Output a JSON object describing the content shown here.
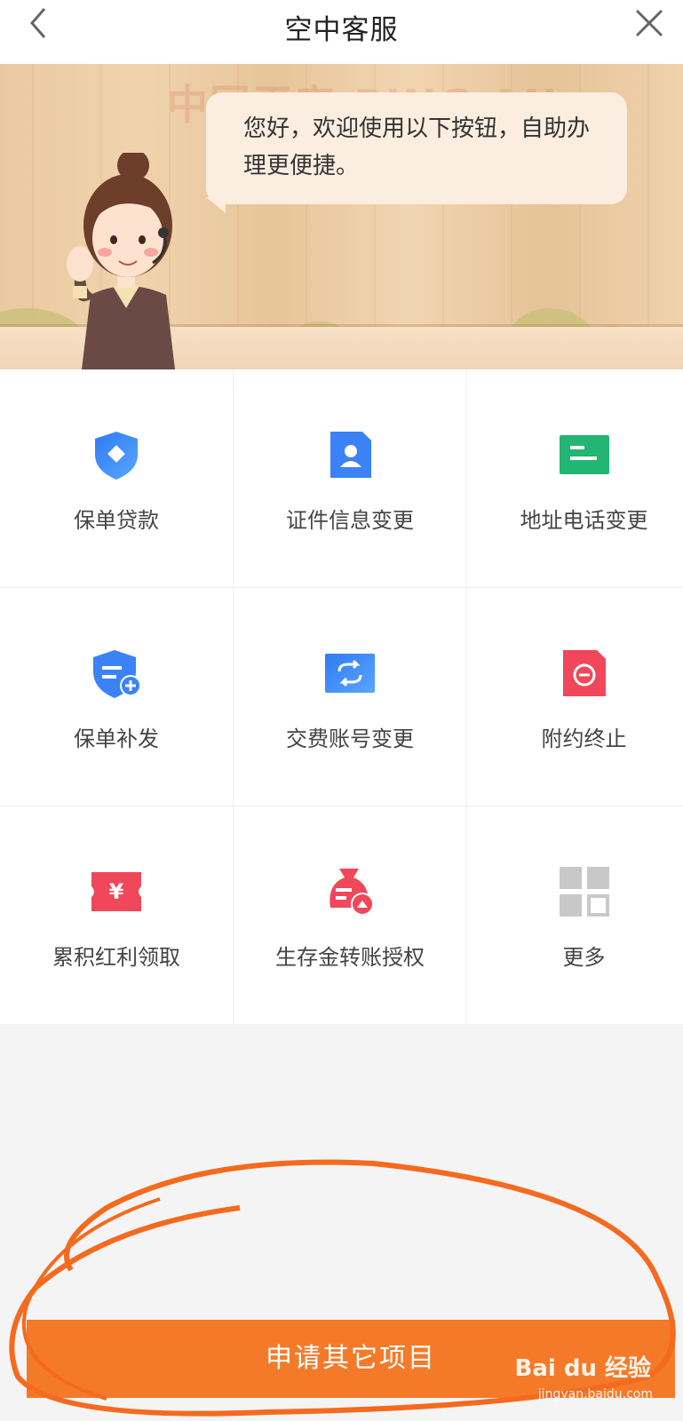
{
  "header": {
    "title": "空中客服"
  },
  "banner": {
    "watermark": "中国平安 PING AN",
    "greeting": "您好，欢迎使用以下按钮，自助办理更便捷。"
  },
  "services": [
    {
      "label": "保单贷款",
      "icon": "shield-diamond-icon"
    },
    {
      "label": "证件信息变更",
      "icon": "id-card-icon"
    },
    {
      "label": "地址电话变更",
      "icon": "address-card-icon"
    },
    {
      "label": "保单补发",
      "icon": "policy-add-icon"
    },
    {
      "label": "交费账号变更",
      "icon": "account-swap-icon"
    },
    {
      "label": "附约终止",
      "icon": "terminate-icon"
    },
    {
      "label": "累积红利领取",
      "icon": "yuan-ticket-icon"
    },
    {
      "label": "生存金转账授权",
      "icon": "money-bag-icon"
    },
    {
      "label": "更多",
      "icon": "more-grid-icon"
    }
  ],
  "bottom": {
    "button_label": "申请其它项目"
  },
  "watermark": {
    "brand": "Bai du 经验",
    "url": "jingyan.baidu.com"
  },
  "colors": {
    "accent": "#f47a2a",
    "blue": "#3b82f6",
    "green": "#22b573",
    "red": "#f0475a"
  }
}
